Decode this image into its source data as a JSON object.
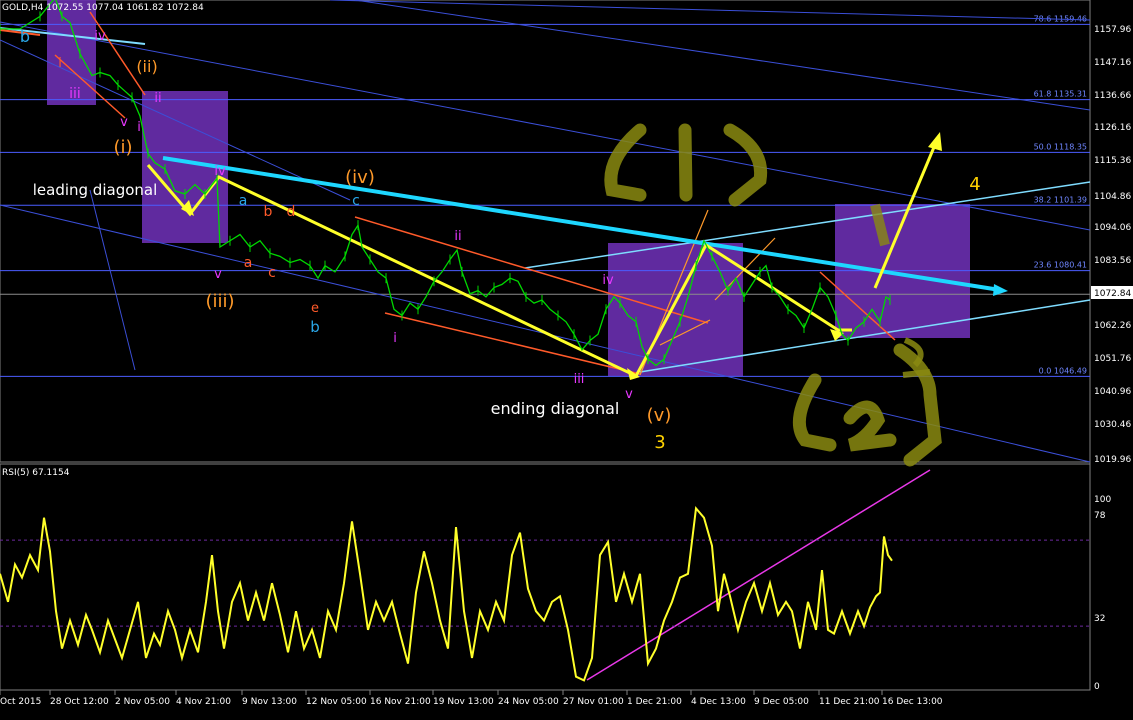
{
  "chart_data": [
    {
      "type": "line",
      "header": "GOLD,H4 1072.55 1077.04 1061.82 1072.84",
      "y_ticks": [
        "1157.96",
        "1147.16",
        "1136.66",
        "1126.16",
        "1115.36",
        "1104.86",
        "1094.06",
        "1083.56",
        "1072.84",
        "1062.26",
        "1051.76",
        "1040.96",
        "1030.46",
        "1019.96"
      ],
      "x_ticks": [
        "Oct 2015",
        "28 Oct 12:00",
        "2 Nov 05:00",
        "4 Nov 21:00",
        "9 Nov 13:00",
        "12 Nov 05:00",
        "16 Nov 21:00",
        "19 Nov 13:00",
        "24 Nov 05:00",
        "27 Nov 01:00",
        "1 Dec 21:00",
        "4 Dec 13:00",
        "9 Dec 05:00",
        "11 Dec 21:00",
        "16 Dec 13:00"
      ],
      "last_price": "1072.84",
      "fib_levels": [
        {
          "label": "78.6 1159.46",
          "price": 1159.46
        },
        {
          "label": "61.8 1135.31",
          "price": 1135.31
        },
        {
          "label": "50.0 1118.35",
          "price": 1118.35
        },
        {
          "label": "38.2 1101.39",
          "price": 1101.39
        },
        {
          "label": "23.6 1080.41",
          "price": 1080.41
        },
        {
          "label": "0.0 1046.49",
          "price": 1046.49
        }
      ],
      "price_path": [
        [
          0,
          1158
        ],
        [
          20,
          1158
        ],
        [
          40,
          1162
        ],
        [
          55,
          1168
        ],
        [
          62,
          1162
        ],
        [
          70,
          1160
        ],
        [
          80,
          1150
        ],
        [
          92,
          1143
        ],
        [
          100,
          1144
        ],
        [
          110,
          1143
        ],
        [
          118,
          1140
        ],
        [
          125,
          1138
        ],
        [
          132,
          1136
        ],
        [
          140,
          1130
        ],
        [
          148,
          1118
        ],
        [
          155,
          1115
        ],
        [
          165,
          1113
        ],
        [
          175,
          1106
        ],
        [
          185,
          1105
        ],
        [
          195,
          1108
        ],
        [
          205,
          1105
        ],
        [
          212,
          1108
        ],
        [
          217,
          1110
        ],
        [
          220,
          1088
        ],
        [
          230,
          1090
        ],
        [
          240,
          1092
        ],
        [
          250,
          1088
        ],
        [
          260,
          1090
        ],
        [
          270,
          1086
        ],
        [
          280,
          1085
        ],
        [
          290,
          1083
        ],
        [
          300,
          1084
        ],
        [
          310,
          1082
        ],
        [
          318,
          1078
        ],
        [
          325,
          1082
        ],
        [
          335,
          1080
        ],
        [
          345,
          1085
        ],
        [
          352,
          1092
        ],
        [
          358,
          1095
        ],
        [
          362,
          1088
        ],
        [
          370,
          1084
        ],
        [
          378,
          1080
        ],
        [
          386,
          1078
        ],
        [
          394,
          1068
        ],
        [
          402,
          1066
        ],
        [
          410,
          1070
        ],
        [
          418,
          1068
        ],
        [
          426,
          1072
        ],
        [
          434,
          1077
        ],
        [
          442,
          1080
        ],
        [
          450,
          1084
        ],
        [
          457,
          1087
        ],
        [
          462,
          1080
        ],
        [
          470,
          1073
        ],
        [
          478,
          1074
        ],
        [
          486,
          1072
        ],
        [
          494,
          1075
        ],
        [
          502,
          1076
        ],
        [
          510,
          1078
        ],
        [
          518,
          1077
        ],
        [
          526,
          1072
        ],
        [
          534,
          1070
        ],
        [
          542,
          1071
        ],
        [
          550,
          1068
        ],
        [
          558,
          1066
        ],
        [
          566,
          1064
        ],
        [
          574,
          1060
        ],
        [
          582,
          1055
        ],
        [
          590,
          1058
        ],
        [
          598,
          1060
        ],
        [
          606,
          1068
        ],
        [
          614,
          1072
        ],
        [
          620,
          1070
        ],
        [
          628,
          1066
        ],
        [
          636,
          1064
        ],
        [
          642,
          1056
        ],
        [
          648,
          1052
        ],
        [
          656,
          1050
        ],
        [
          664,
          1052
        ],
        [
          672,
          1058
        ],
        [
          680,
          1064
        ],
        [
          688,
          1072
        ],
        [
          696,
          1082
        ],
        [
          704,
          1090
        ],
        [
          712,
          1085
        ],
        [
          720,
          1080
        ],
        [
          728,
          1074
        ],
        [
          736,
          1078
        ],
        [
          744,
          1072
        ],
        [
          752,
          1076
        ],
        [
          760,
          1080
        ],
        [
          766,
          1082
        ],
        [
          772,
          1075
        ],
        [
          780,
          1072
        ],
        [
          788,
          1068
        ],
        [
          796,
          1066
        ],
        [
          804,
          1062
        ],
        [
          812,
          1068
        ],
        [
          820,
          1075
        ],
        [
          828,
          1072
        ],
        [
          836,
          1066
        ],
        [
          842,
          1060
        ],
        [
          848,
          1058
        ],
        [
          856,
          1062
        ],
        [
          864,
          1064
        ],
        [
          872,
          1068
        ],
        [
          880,
          1064
        ],
        [
          886,
          1072
        ],
        [
          890,
          1071
        ]
      ],
      "annotations": [
        {
          "text": "b",
          "color": "#2aa7e8"
        },
        {
          "text": "i",
          "color": "#ff5a2a"
        },
        {
          "text": "iii",
          "color": "#e838ff"
        },
        {
          "text": "iv",
          "color": "#e838ff"
        },
        {
          "text": "v",
          "color": "#e838ff"
        },
        {
          "text": "(ii)",
          "color": "#ff9a2a"
        },
        {
          "text": "ii",
          "color": "#e838ff"
        },
        {
          "text": "i",
          "color": "#e838ff"
        },
        {
          "text": "(i)",
          "color": "#ff9a2a"
        },
        {
          "text": "leading diagonal",
          "color": "#ffffff"
        },
        {
          "text": "iv",
          "color": "#e838ff"
        },
        {
          "text": "a",
          "color": "#2aa7e8"
        },
        {
          "text": "b",
          "color": "#ff5a2a"
        },
        {
          "text": "d",
          "color": "#ff5a2a"
        },
        {
          "text": "(iv)",
          "color": "#ff9a2a"
        },
        {
          "text": "c",
          "color": "#2aa7e8"
        },
        {
          "text": "v",
          "color": "#e838ff"
        },
        {
          "text": "a",
          "color": "#ff5a2a"
        },
        {
          "text": "c",
          "color": "#ff5a2a"
        },
        {
          "text": "(iii)",
          "color": "#ff9a2a"
        },
        {
          "text": "e",
          "color": "#ff5a2a"
        },
        {
          "text": "b",
          "color": "#2aa7e8"
        },
        {
          "text": "ii",
          "color": "#e838ff"
        },
        {
          "text": "i",
          "color": "#e838ff"
        },
        {
          "text": "iv",
          "color": "#e838ff"
        },
        {
          "text": "iii",
          "color": "#e838ff"
        },
        {
          "text": "v",
          "color": "#e838ff"
        },
        {
          "text": "ending diagonal",
          "color": "#ffffff"
        },
        {
          "text": "(v)",
          "color": "#ff9a2a"
        },
        {
          "text": "3",
          "color": "#ffd200"
        },
        {
          "text": "4",
          "color": "#ffd200"
        }
      ],
      "colors": {
        "price": "#00d800",
        "trendline": "#1ed7ff",
        "channel": "#7fdcff",
        "zone": "#6a2fb0",
        "arrow": "#ffff2a",
        "fib": "#4b5dff",
        "handwriting": "#8a8a10"
      }
    },
    {
      "type": "line",
      "header": "RSI(5) 67.1154",
      "y_ticks": [
        "100",
        "78",
        "32",
        "0"
      ],
      "levels": [
        78,
        32
      ],
      "last_value": 67.1154,
      "values": [
        [
          0,
          60
        ],
        [
          8,
          45
        ],
        [
          15,
          65
        ],
        [
          22,
          58
        ],
        [
          30,
          70
        ],
        [
          38,
          62
        ],
        [
          44,
          90
        ],
        [
          50,
          72
        ],
        [
          56,
          40
        ],
        [
          62,
          20
        ],
        [
          70,
          35
        ],
        [
          78,
          22
        ],
        [
          86,
          38
        ],
        [
          92,
          30
        ],
        [
          100,
          18
        ],
        [
          108,
          35
        ],
        [
          115,
          25
        ],
        [
          122,
          15
        ],
        [
          130,
          30
        ],
        [
          138,
          45
        ],
        [
          146,
          15
        ],
        [
          154,
          28
        ],
        [
          160,
          22
        ],
        [
          168,
          40
        ],
        [
          175,
          30
        ],
        [
          182,
          15
        ],
        [
          190,
          30
        ],
        [
          198,
          18
        ],
        [
          206,
          45
        ],
        [
          212,
          70
        ],
        [
          218,
          40
        ],
        [
          224,
          20
        ],
        [
          232,
          45
        ],
        [
          240,
          55
        ],
        [
          248,
          35
        ],
        [
          256,
          50
        ],
        [
          264,
          35
        ],
        [
          272,
          55
        ],
        [
          280,
          38
        ],
        [
          288,
          18
        ],
        [
          296,
          40
        ],
        [
          304,
          20
        ],
        [
          312,
          30
        ],
        [
          320,
          15
        ],
        [
          328,
          40
        ],
        [
          336,
          30
        ],
        [
          344,
          55
        ],
        [
          352,
          88
        ],
        [
          360,
          60
        ],
        [
          368,
          30
        ],
        [
          376,
          45
        ],
        [
          384,
          35
        ],
        [
          392,
          45
        ],
        [
          400,
          28
        ],
        [
          408,
          12
        ],
        [
          416,
          50
        ],
        [
          424,
          72
        ],
        [
          432,
          55
        ],
        [
          440,
          35
        ],
        [
          448,
          20
        ],
        [
          456,
          85
        ],
        [
          464,
          40
        ],
        [
          472,
          15
        ],
        [
          480,
          40
        ],
        [
          488,
          30
        ],
        [
          496,
          45
        ],
        [
          504,
          35
        ],
        [
          512,
          70
        ],
        [
          520,
          82
        ],
        [
          528,
          52
        ],
        [
          536,
          40
        ],
        [
          544,
          35
        ],
        [
          552,
          45
        ],
        [
          560,
          48
        ],
        [
          568,
          30
        ],
        [
          576,
          5
        ],
        [
          584,
          3
        ],
        [
          592,
          15
        ],
        [
          600,
          70
        ],
        [
          608,
          77
        ],
        [
          616,
          45
        ],
        [
          624,
          60
        ],
        [
          632,
          45
        ],
        [
          640,
          60
        ],
        [
          648,
          12
        ],
        [
          656,
          20
        ],
        [
          664,
          35
        ],
        [
          672,
          45
        ],
        [
          680,
          58
        ],
        [
          688,
          60
        ],
        [
          696,
          95
        ],
        [
          704,
          90
        ],
        [
          712,
          75
        ],
        [
          718,
          40
        ],
        [
          724,
          60
        ],
        [
          730,
          48
        ],
        [
          738,
          30
        ],
        [
          746,
          45
        ],
        [
          754,
          55
        ],
        [
          762,
          40
        ],
        [
          770,
          55
        ],
        [
          778,
          38
        ],
        [
          786,
          45
        ],
        [
          792,
          40
        ],
        [
          800,
          20
        ],
        [
          808,
          45
        ],
        [
          816,
          30
        ],
        [
          822,
          62
        ],
        [
          828,
          30
        ],
        [
          834,
          28
        ],
        [
          842,
          40
        ],
        [
          850,
          28
        ],
        [
          858,
          40
        ],
        [
          864,
          32
        ],
        [
          870,
          42
        ],
        [
          876,
          48
        ],
        [
          880,
          50
        ],
        [
          884,
          80
        ],
        [
          888,
          70
        ],
        [
          892,
          67
        ]
      ]
    }
  ]
}
